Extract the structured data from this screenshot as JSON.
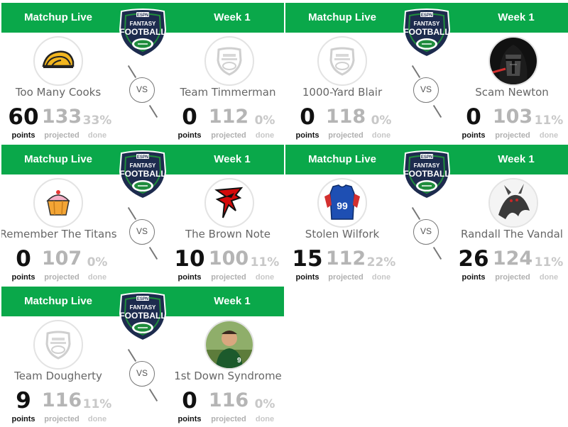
{
  "header": {
    "live_label": "Matchup Live",
    "week_label": "Week 1",
    "vs_label": "VS",
    "points_label": "points",
    "projected_label": "projected",
    "done_label": "done"
  },
  "matchups": [
    {
      "left": {
        "name": "Too Many Cooks",
        "points": "60",
        "projected": "133",
        "done": "33%",
        "avatar": "taco-icon"
      },
      "right": {
        "name": "Team Timmerman",
        "points": "0",
        "projected": "112",
        "done": "0%",
        "avatar": "default-football-icon"
      }
    },
    {
      "left": {
        "name": "1000-Yard Blair",
        "points": "0",
        "projected": "118",
        "done": "0%",
        "avatar": "default-football-icon"
      },
      "right": {
        "name": "Scam Newton",
        "points": "0",
        "projected": "103",
        "done": "11%",
        "avatar": "kylo-ren-avatar"
      }
    },
    {
      "left": {
        "name": "Remember The Titans",
        "points": "0",
        "projected": "107",
        "done": "0%",
        "avatar": "cupcake-icon"
      },
      "right": {
        "name": "The Brown Note",
        "points": "10",
        "projected": "100",
        "done": "11%",
        "avatar": "falcons-logo"
      }
    },
    {
      "left": {
        "name": "Stolen Wilfork",
        "points": "15",
        "projected": "112",
        "done": "22%",
        "avatar": "jersey-99-icon"
      },
      "right": {
        "name": "Randall The Vandal",
        "points": "26",
        "projected": "124",
        "done": "11%",
        "avatar": "creature-avatar"
      }
    },
    {
      "left": {
        "name": "Team Dougherty",
        "points": "9",
        "projected": "116",
        "done": "11%",
        "avatar": "default-football-icon"
      },
      "right": {
        "name": "1st Down Syndrome",
        "points": "0",
        "projected": "116",
        "done": "0%",
        "avatar": "player-photo-avatar"
      }
    }
  ],
  "logo": {
    "top": "ESPN",
    "line1": "FANTASY",
    "line2": "FOOTBALL"
  },
  "colors": {
    "header_green": "#0aa84a",
    "logo_navy": "#1d2b4e",
    "logo_green": "#1f8c3c"
  }
}
